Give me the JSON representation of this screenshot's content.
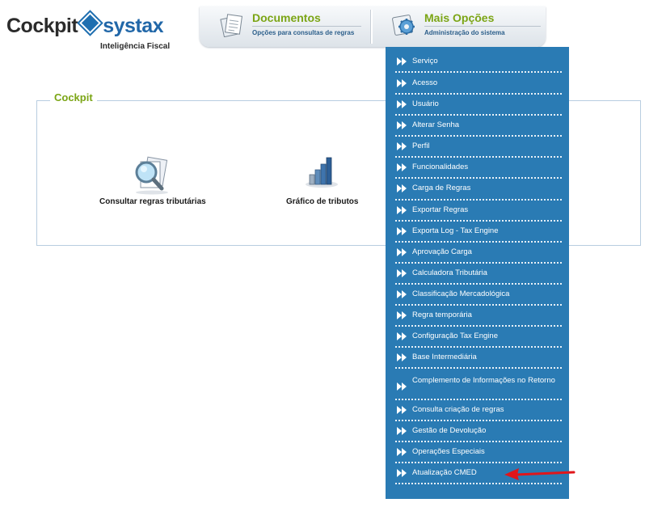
{
  "logo": {
    "cockpit": "Cockpit",
    "brand": "systax",
    "tagline": "Inteligência Fiscal",
    "brand_color": "#2167a8"
  },
  "tabs": [
    {
      "title": "Documentos",
      "subtitle": "Opções para consultas de regras",
      "icon": "documents-icon"
    },
    {
      "title": "Mais Opções",
      "subtitle": "Administração do sistema",
      "icon": "settings-gear-icon"
    }
  ],
  "cockpit": {
    "title": "Cockpit",
    "shortcuts": [
      {
        "label": "Consultar regras tributárias",
        "icon": "magnifier-documents-icon"
      },
      {
        "label": "Gráfico de tributos",
        "icon": "bar-chart-icon"
      }
    ]
  },
  "menu": {
    "background": "#2a7bb4",
    "items": [
      {
        "label": "Serviço"
      },
      {
        "label": "Acesso"
      },
      {
        "label": "Usuário"
      },
      {
        "label": "Alterar Senha"
      },
      {
        "label": "Perfil"
      },
      {
        "label": "Funcionalidades"
      },
      {
        "label": "Carga de Regras"
      },
      {
        "label": "Exportar Regras"
      },
      {
        "label": "Exporta Log - Tax Engine"
      },
      {
        "label": "Aprovação Carga"
      },
      {
        "label": "Calculadora Tributária"
      },
      {
        "label": "Classificação Mercadológica"
      },
      {
        "label": "Regra temporária"
      },
      {
        "label": "Configuração Tax Engine"
      },
      {
        "label": "Base Intermediária"
      },
      {
        "label": "Complemento de Informações no Retorno"
      },
      {
        "label": "Consulta criação de regras"
      },
      {
        "label": "Gestão de Devolução"
      },
      {
        "label": "Operações Especiais"
      },
      {
        "label": "Atualização CMED"
      }
    ]
  },
  "annotation": {
    "color": "#e0161b",
    "icon": "red-arrow-pointer"
  }
}
